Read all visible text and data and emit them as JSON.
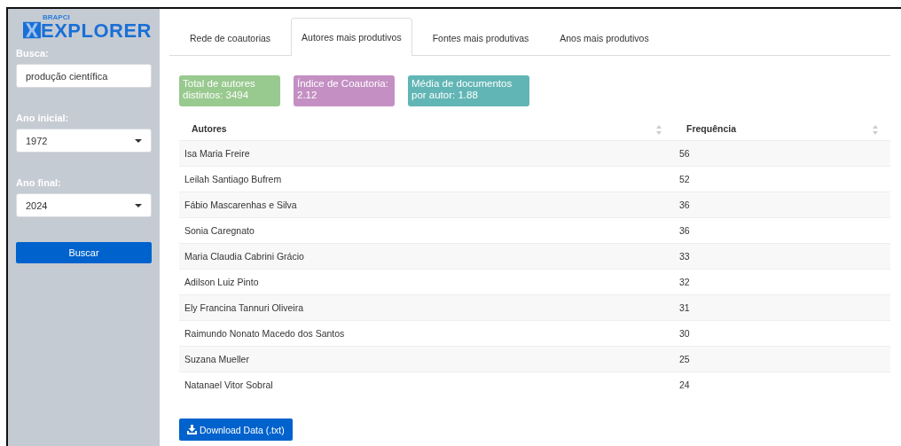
{
  "sidebar": {
    "logo": {
      "small": "BRAPCI",
      "name": "EXPLORER"
    },
    "search": {
      "label": "Busca:",
      "value": "produção científica"
    },
    "start_year": {
      "label": "Ano inicial:",
      "value": "1972"
    },
    "end_year": {
      "label": "Ano final:",
      "value": "2024"
    },
    "button": "Buscar"
  },
  "tabs": [
    {
      "label": "Rede de coautorias",
      "selected": false
    },
    {
      "label": "Autores mais produtivos",
      "selected": true
    },
    {
      "label": "Fontes mais produtivas",
      "selected": false
    },
    {
      "label": "Anos mais produtivos",
      "selected": false
    }
  ],
  "value_boxes": [
    {
      "text": "Total de autores distintos: 3494",
      "color": "#98c98e"
    },
    {
      "text": "Índice de Coautoria: 2.12",
      "color": "#c48fc3"
    },
    {
      "text": "Média de documentos por autor: 1.88",
      "color": "#62b5b5"
    }
  ],
  "table": {
    "columns": [
      "Autores",
      "Frequência"
    ],
    "rows": [
      [
        "Isa Maria Freire",
        "56"
      ],
      [
        "Leilah Santiago Bufrem",
        "52"
      ],
      [
        "Fábio Mascarenhas e Silva",
        "36"
      ],
      [
        "Sonia Caregnato",
        "36"
      ],
      [
        "Maria Claudia Cabrini Grácio",
        "33"
      ],
      [
        "Adilson Luiz Pinto",
        "32"
      ],
      [
        "Ely Francina Tannuri Oliveira",
        "31"
      ],
      [
        "Raimundo Nonato Macedo dos Santos",
        "30"
      ],
      [
        "Suzana Mueller",
        "25"
      ],
      [
        "Natanael Vitor Sobral",
        "24"
      ]
    ]
  },
  "download_button": "Download Data (.txt)"
}
